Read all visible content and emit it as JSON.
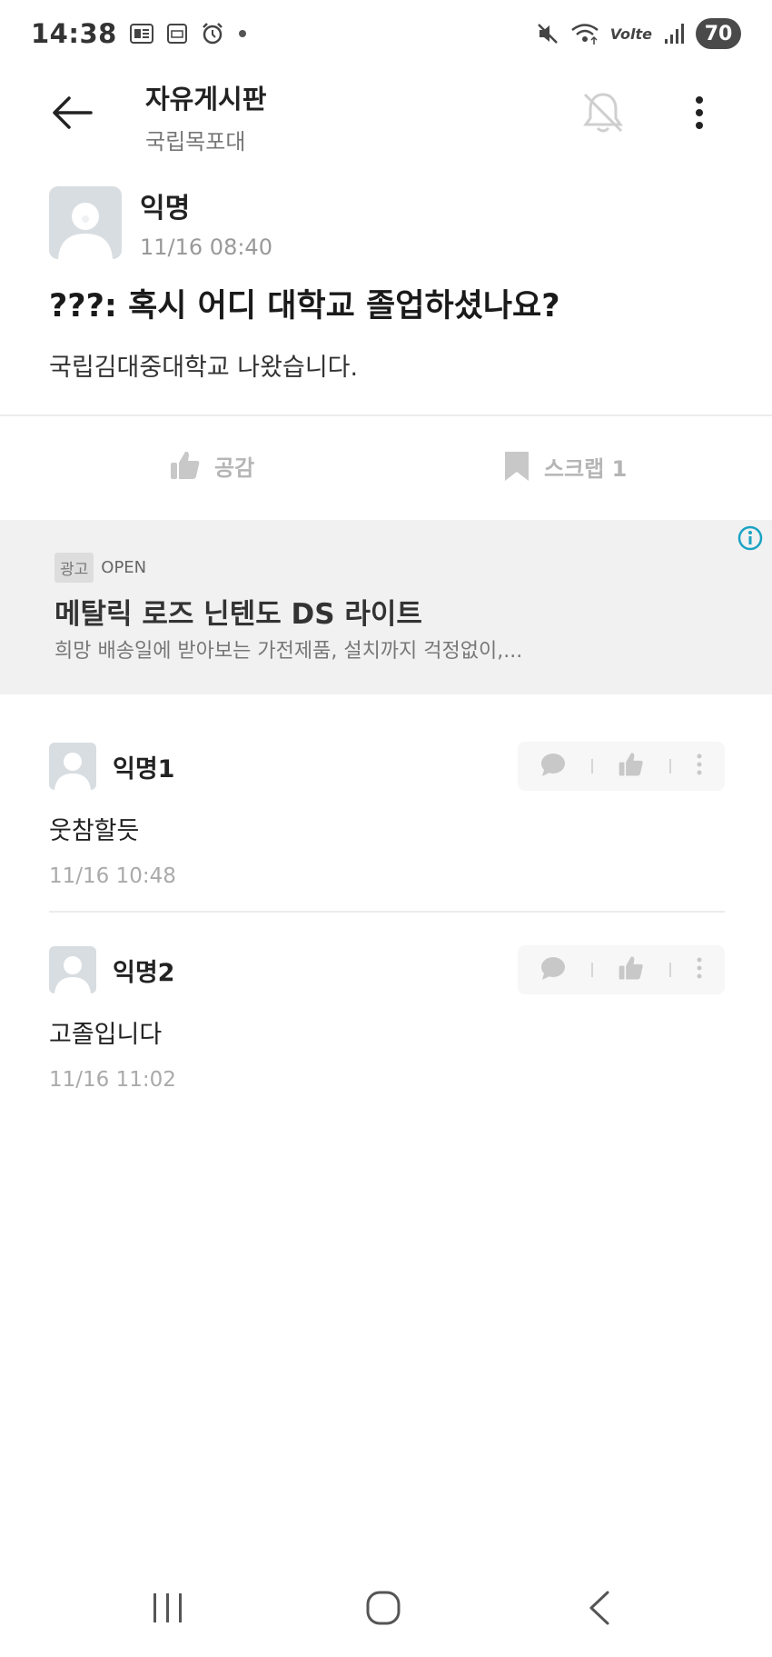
{
  "status_bar": {
    "time": "14:38",
    "network_label": "Volte",
    "battery": "70",
    "icons": [
      "ge-icon",
      "sd-icon",
      "alarm-icon",
      "dot-icon",
      "mute-icon",
      "wifi-icon",
      "signal-icon",
      "battery-icon"
    ]
  },
  "app_bar": {
    "title": "자유게시판",
    "subtitle": "국립목포대",
    "icons": [
      "back-arrow-icon",
      "bell-off-icon",
      "more-vert-icon"
    ]
  },
  "post": {
    "author": "익명",
    "time": "11/16 08:40",
    "title": "???: 혹시 어디 대학교 졸업하셨나요?",
    "body": "국립김대중대학교 나왔습니다.",
    "like_label": "공감",
    "scrap_label": "스크랩 1"
  },
  "ad": {
    "badge": "광고",
    "tag": "OPEN",
    "title": "메탈릭 로즈 닌텐도 DS 라이트",
    "description": "희망 배송일에 받아보는 가전제품, 설치까지 걱정없이,..."
  },
  "comments": [
    {
      "author": "익명1",
      "text": "웃참할듯",
      "time": "11/16 10:48"
    },
    {
      "author": "익명2",
      "text": "고졸입니다",
      "time": "11/16 11:02"
    }
  ],
  "colors": {
    "text_primary": "#222222",
    "text_muted": "#999999",
    "icon_muted": "#c8c8c8",
    "ad_background": "#f1f1f1",
    "info_accent": "#1aa3c4"
  }
}
